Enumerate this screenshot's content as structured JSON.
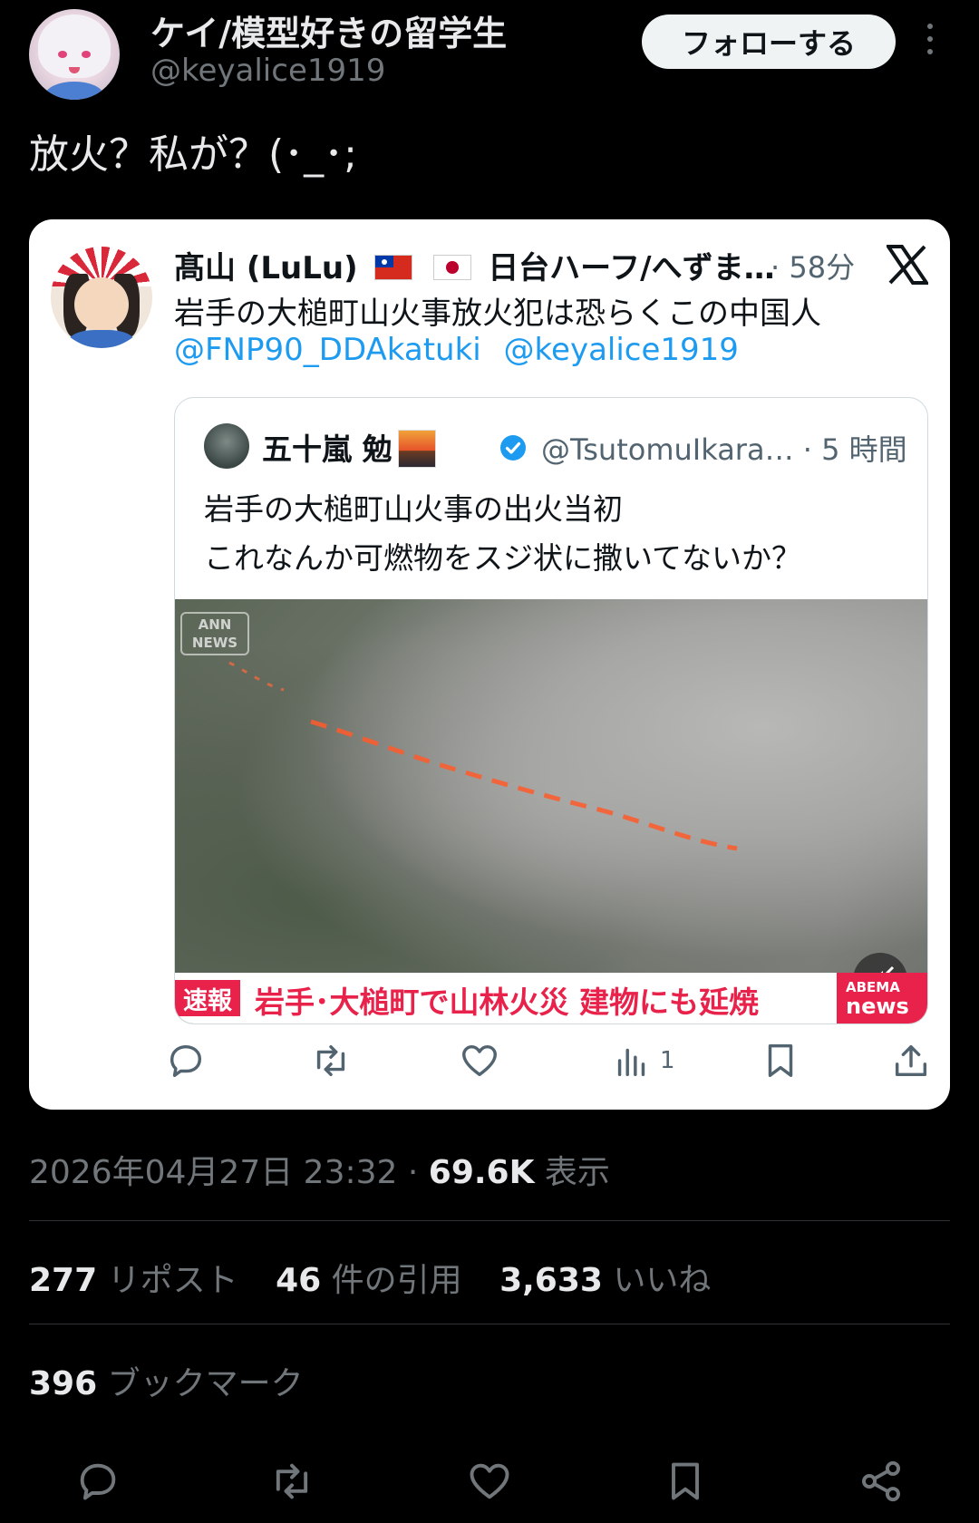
{
  "author": {
    "display_name": "ケイ/模型好きの留学生",
    "handle": "@keyalice1919",
    "follow_label": "フォローする"
  },
  "tweet": {
    "text": "放火？私が？(･_･;"
  },
  "quoted": {
    "display_name": "髙山 (LuLu)",
    "name_suffix": "日台ハーフ/へずま…",
    "time": "· 58分",
    "text": "岩手の大槌町山火事放火犯は恐らくこの中国人",
    "mentions": [
      "@FNP90_DDAkatuki",
      "@keyalice1919"
    ],
    "nested": {
      "display_name": "五十嵐 勉",
      "handle_time": "@TsutomuIkara… · 5 時間",
      "text_lines": [
        "岩手の大槌町山火事の出火当初",
        "これなんか可燃物をスジ状に撒いてないか？"
      ],
      "video": {
        "ann_logo": "ANN NEWS",
        "breaking_tag": "速報",
        "breaking_text": "岩手･大槌町で山林火災 建物にも延焼",
        "abema_top": "ABEMA",
        "abema_bottom": "news"
      }
    },
    "actions": {
      "view_count": "1"
    }
  },
  "meta": {
    "timestamp": "2026年04月27日 23:32 · ",
    "views_value": "69.6K",
    "views_label": " 表示"
  },
  "stats": {
    "reposts_value": "277",
    "reposts_label": " リポスト",
    "quotes_value": "46",
    "quotes_label": " 件の引用",
    "likes_value": "3,633",
    "likes_label": " いいね",
    "bookmarks_value": "396",
    "bookmarks_label": " ブックマーク"
  },
  "icons": {
    "colors": {
      "background": "#000000",
      "card": "#ffffff",
      "link": "#1d9bf0",
      "breaking_red": "#e8224a",
      "muted": "#71767b"
    }
  }
}
